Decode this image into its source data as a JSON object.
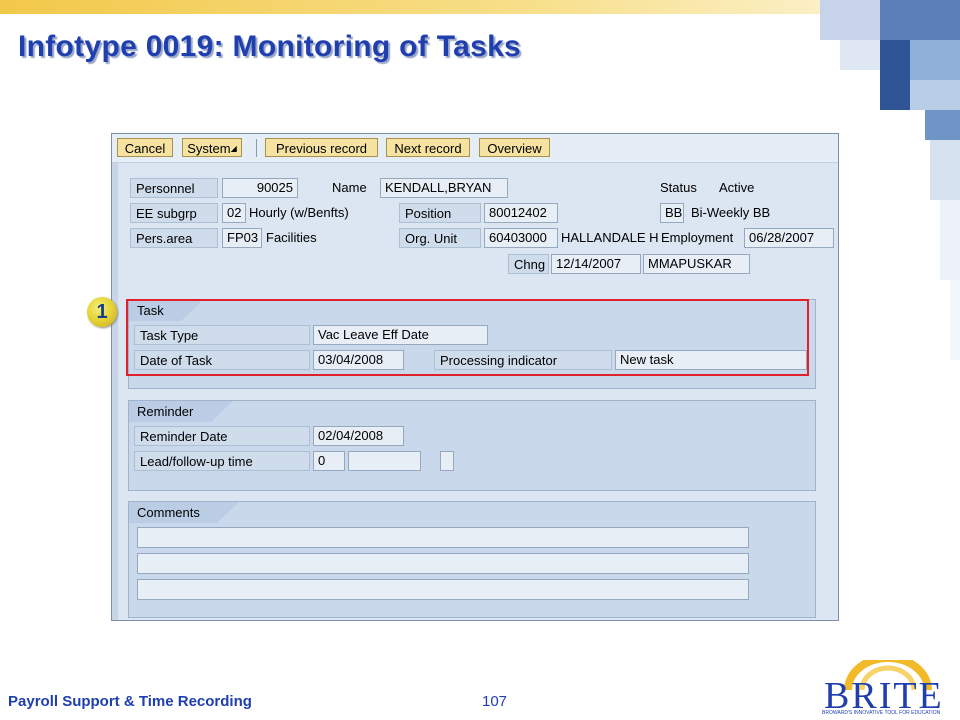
{
  "slide": {
    "title": "Infotype 0019: Monitoring of Tasks",
    "footer_left": "Payroll Support & Time Recording",
    "page_number": "107",
    "logo_text": "BRITE",
    "logo_subtext": "BROWARD'S INNOVATIVE TOOL FOR EDUCATION",
    "callout_number": "1",
    "colors": {
      "title": "#1f3fae",
      "accent_gold": "#f2c84a",
      "highlight_red": "#e0202a"
    }
  },
  "toolbar": {
    "cancel": "Cancel",
    "system": "System",
    "previous_record": "Previous record",
    "next_record": "Next record",
    "overview": "Overview"
  },
  "header": {
    "personnel_label": "Personnel",
    "personnel_value": "90025",
    "name_label": "Name",
    "name_value": "KENDALL,BRYAN",
    "status_label": "Status",
    "status_value": "Active",
    "ee_subgrp_label": "EE subgrp",
    "ee_subgrp_code": "02",
    "ee_subgrp_text": "Hourly  (w/Benfts)",
    "position_label": "Position",
    "position_value": "80012402",
    "payroll_area_code": "BB",
    "payroll_area_text": "Bi-Weekly BB",
    "pers_area_label": "Pers.area",
    "pers_area_code": "FP03",
    "pers_area_text": "Facilities",
    "org_unit_label": "Org. Unit",
    "org_unit_value": "60403000",
    "org_unit_text": "HALLANDALE H",
    "employment_label": "Employment",
    "employment_value": "06/28/2007",
    "chng_label": "Chng",
    "chng_date": "12/14/2007",
    "chng_user": "MMAPUSKAR"
  },
  "task": {
    "group_title": "Task",
    "task_type_label": "Task Type",
    "task_type_value": "Vac Leave Eff Date",
    "date_label": "Date of Task",
    "date_value": "03/04/2008",
    "processing_label": "Processing indicator",
    "processing_value": "New task"
  },
  "reminder": {
    "group_title": "Reminder",
    "reminder_date_label": "Reminder Date",
    "reminder_date_value": "02/04/2008",
    "lead_label": "Lead/follow-up time",
    "lead_value": "0"
  },
  "comments": {
    "group_title": "Comments"
  }
}
